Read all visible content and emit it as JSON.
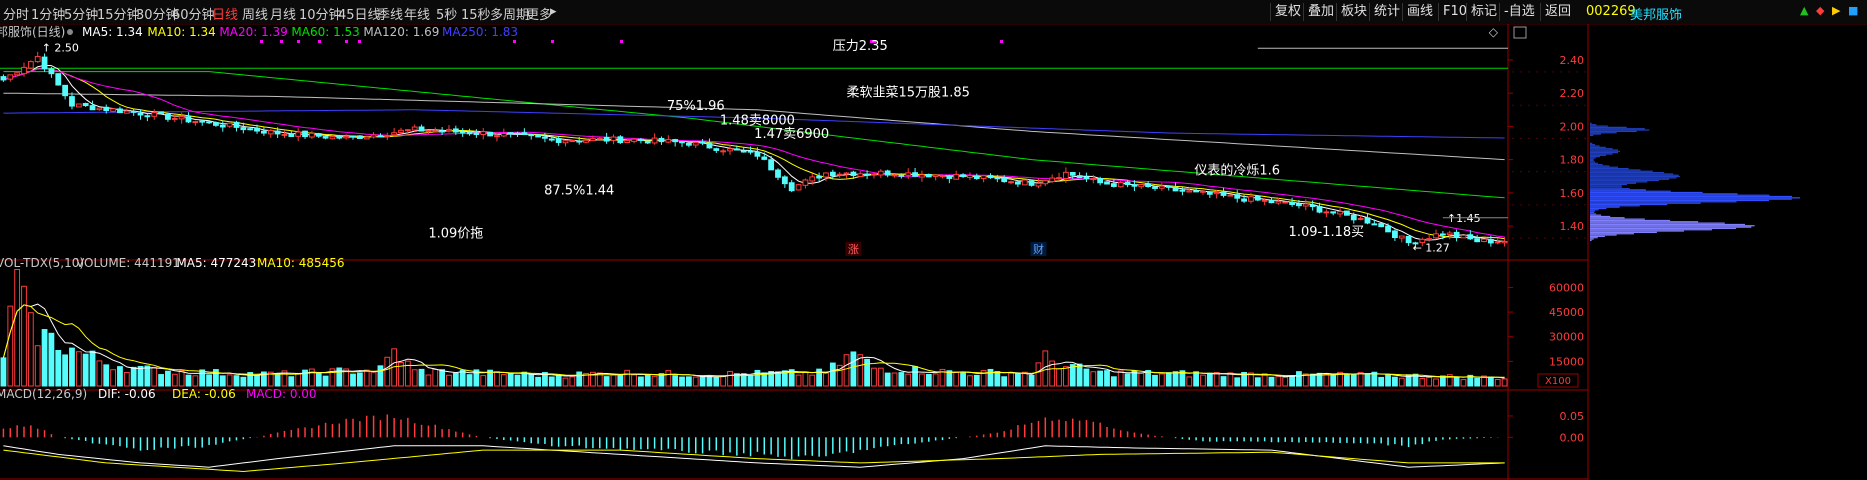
{
  "toolbar": {
    "periods": [
      "分时",
      "1分钟",
      "5分钟",
      "15分钟",
      "30分钟",
      "60分钟",
      "日线",
      "周线",
      "月线",
      "10分钟",
      "45日线",
      "季线",
      "年线",
      "5秒",
      "15秒",
      "多周期",
      "更多"
    ],
    "active_period": "日线",
    "right_buttons": [
      "复权",
      "叠加",
      "板块",
      "统计",
      "画线",
      "F10",
      "标记",
      "-自选",
      "返回"
    ]
  },
  "stock": {
    "code": "002269",
    "name": "美邦服饰"
  },
  "colors": {
    "up": "#ff3b3b",
    "down": "#54fcfc",
    "ma5": "#ffffff",
    "ma10": "#ffff00",
    "ma20": "#ff00ff",
    "ma60": "#00e000",
    "ma120": "#c0c0c0",
    "ma250": "#4040ff",
    "axis": "#9a0000",
    "text": "#c8c8c8"
  },
  "chart_data": [
    {
      "type": "candlestick",
      "title": "邦服饰(日线)",
      "indicators": [
        {
          "name": "MA5",
          "label": "MA5: 1.34",
          "value": 1.34
        },
        {
          "name": "MA10",
          "label": "MA10: 1.34",
          "value": 1.34
        },
        {
          "name": "MA20",
          "label": "MA20: 1.39",
          "value": 1.39
        },
        {
          "name": "MA60",
          "label": "MA60: 1.53",
          "value": 1.53
        },
        {
          "name": "MA120",
          "label": "MA120: 1.69",
          "value": 1.69
        },
        {
          "name": "MA250",
          "label": "MA250: 1.83",
          "value": 1.83
        }
      ],
      "y_ticks": [
        "2.40",
        "2.20",
        "2.00",
        "1.80",
        "1.60",
        "1.40"
      ],
      "ylim": [
        1.22,
        2.52
      ],
      "n_bars": 220,
      "x_range": [
        0,
        219
      ],
      "high_marker": {
        "text": "2.50",
        "x": 5,
        "price": 2.5
      },
      "low_marker": {
        "text": "1.27",
        "x": 205,
        "price": 1.27
      },
      "last_marker": {
        "text": "1.45",
        "x": 210,
        "price": 1.45
      },
      "annotations": [
        {
          "text": "压力2.35",
          "x": 125,
          "price": 2.46
        },
        {
          "text": "柔软韭菜15万股1.85",
          "x": 132,
          "price": 2.18
        },
        {
          "text": "75%1.96",
          "x": 101,
          "price": 2.1
        },
        {
          "text": "1.48卖8000",
          "x": 110,
          "price": 2.01
        },
        {
          "text": "1.47卖6900",
          "x": 115,
          "price": 1.93
        },
        {
          "text": "仪表的冷烁1.6",
          "x": 180,
          "price": 1.71
        },
        {
          "text": "87.5%1.44",
          "x": 84,
          "price": 1.59
        },
        {
          "text": "1.09价拖",
          "x": 66,
          "price": 1.33
        },
        {
          "text": "1.09-1.18买",
          "x": 193,
          "price": 1.34
        }
      ],
      "markers": [
        {
          "text": "涨",
          "x": 124
        },
        {
          "text": "财",
          "x": 151
        }
      ],
      "h_lines": [
        {
          "price": 2.35,
          "color": "#00d000"
        },
        {
          "price": 2.47,
          "color": "#bbbbbb",
          "x_start": 183
        }
      ],
      "key_points": [
        [
          0,
          2.28
        ],
        [
          5,
          2.42
        ],
        [
          10,
          2.13
        ],
        [
          20,
          2.08
        ],
        [
          30,
          2.02
        ],
        [
          40,
          1.96
        ],
        [
          50,
          1.93
        ],
        [
          60,
          1.98
        ],
        [
          70,
          1.96
        ],
        [
          80,
          1.92
        ],
        [
          92,
          1.92
        ],
        [
          100,
          1.9
        ],
        [
          110,
          1.83
        ],
        [
          115,
          1.63
        ],
        [
          120,
          1.72
        ],
        [
          130,
          1.72
        ],
        [
          140,
          1.7
        ],
        [
          150,
          1.66
        ],
        [
          155,
          1.72
        ],
        [
          160,
          1.66
        ],
        [
          170,
          1.62
        ],
        [
          180,
          1.57
        ],
        [
          190,
          1.52
        ],
        [
          200,
          1.42
        ],
        [
          205,
          1.3
        ],
        [
          210,
          1.36
        ],
        [
          215,
          1.31
        ],
        [
          219,
          1.31
        ]
      ],
      "ma_key_points": {
        "MA60": [
          [
            0,
            2.33
          ],
          [
            30,
            2.33
          ],
          [
            100,
            2.05
          ],
          [
            150,
            1.8
          ],
          [
            219,
            1.57
          ]
        ],
        "MA120": [
          [
            0,
            2.2
          ],
          [
            40,
            2.18
          ],
          [
            110,
            2.1
          ],
          [
            150,
            1.97
          ],
          [
            219,
            1.8
          ]
        ],
        "MA250": [
          [
            0,
            2.08
          ],
          [
            60,
            2.1
          ],
          [
            110,
            2.05
          ],
          [
            170,
            1.96
          ],
          [
            219,
            1.93
          ]
        ]
      }
    },
    {
      "type": "bar",
      "title": "VOL-TDX(5,10)",
      "values_text": [
        {
          "label": "VOLUME: 441191",
          "color": "#c8c8c8"
        },
        {
          "label": "MA5: 477243",
          "color": "#ffffff"
        },
        {
          "label": "MA10: 485456",
          "color": "#ffff00"
        }
      ],
      "y_ticks": [
        "60000",
        "45000",
        "30000",
        "15000"
      ],
      "unit": "X100",
      "ylim": [
        0,
        70000
      ],
      "key_points": [
        [
          0,
          20000
        ],
        [
          2,
          62000
        ],
        [
          4,
          35000
        ],
        [
          6,
          30000
        ],
        [
          10,
          22000
        ],
        [
          15,
          14000
        ],
        [
          20,
          10000
        ],
        [
          30,
          8000
        ],
        [
          40,
          7000
        ],
        [
          55,
          10000
        ],
        [
          57,
          21000
        ],
        [
          60,
          9000
        ],
        [
          80,
          6500
        ],
        [
          90,
          8000
        ],
        [
          100,
          7000
        ],
        [
          120,
          8000
        ],
        [
          124,
          20000
        ],
        [
          127,
          11000
        ],
        [
          140,
          8000
        ],
        [
          150,
          8000
        ],
        [
          152,
          17000
        ],
        [
          155,
          12000
        ],
        [
          160,
          8000
        ],
        [
          180,
          7000
        ],
        [
          200,
          6500
        ],
        [
          219,
          5000
        ]
      ]
    },
    {
      "type": "bar",
      "title": "MACD(12,26,9)",
      "values_text": [
        {
          "label": "DIF: -0.06",
          "color": "#ffffff"
        },
        {
          "label": "DEA: -0.06",
          "color": "#ffff00"
        },
        {
          "label": "MACD: 0.00",
          "color": "#ff00ff"
        }
      ],
      "y_ticks": [
        "0.05",
        "0.00"
      ],
      "ylim": [
        -0.1,
        0.085
      ],
      "macd_key_points": [
        [
          0,
          0.02
        ],
        [
          4,
          0.03
        ],
        [
          8,
          0.0
        ],
        [
          12,
          -0.01
        ],
        [
          20,
          -0.03
        ],
        [
          30,
          -0.02
        ],
        [
          40,
          0.01
        ],
        [
          50,
          0.04
        ],
        [
          57,
          0.05
        ],
        [
          62,
          0.03
        ],
        [
          70,
          0.0
        ],
        [
          80,
          -0.02
        ],
        [
          95,
          -0.03
        ],
        [
          110,
          -0.04
        ],
        [
          118,
          -0.05
        ],
        [
          125,
          -0.03
        ],
        [
          135,
          -0.01
        ],
        [
          145,
          0.01
        ],
        [
          152,
          0.045
        ],
        [
          158,
          0.04
        ],
        [
          165,
          0.01
        ],
        [
          175,
          -0.01
        ],
        [
          185,
          -0.01
        ],
        [
          200,
          -0.015
        ],
        [
          205,
          -0.02
        ],
        [
          210,
          -0.005
        ],
        [
          219,
          0.0
        ]
      ],
      "dif_key_points": [
        [
          0,
          -0.02
        ],
        [
          8,
          -0.04
        ],
        [
          20,
          -0.06
        ],
        [
          30,
          -0.07
        ],
        [
          40,
          -0.05
        ],
        [
          57,
          -0.02
        ],
        [
          70,
          -0.02
        ],
        [
          90,
          -0.04
        ],
        [
          110,
          -0.06
        ],
        [
          125,
          -0.07
        ],
        [
          140,
          -0.05
        ],
        [
          152,
          -0.02
        ],
        [
          165,
          -0.025
        ],
        [
          185,
          -0.03
        ],
        [
          205,
          -0.07
        ],
        [
          219,
          -0.06
        ]
      ],
      "dea_key_points": [
        [
          0,
          -0.03
        ],
        [
          15,
          -0.06
        ],
        [
          35,
          -0.08
        ],
        [
          50,
          -0.06
        ],
        [
          70,
          -0.03
        ],
        [
          90,
          -0.03
        ],
        [
          110,
          -0.05
        ],
        [
          125,
          -0.06
        ],
        [
          145,
          -0.05
        ],
        [
          160,
          -0.04
        ],
        [
          185,
          -0.035
        ],
        [
          205,
          -0.06
        ],
        [
          219,
          -0.06
        ]
      ]
    }
  ]
}
